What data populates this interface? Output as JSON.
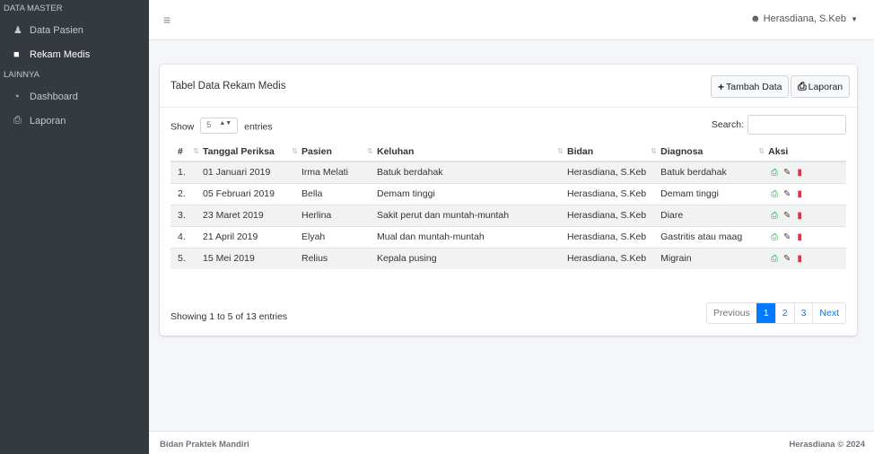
{
  "sidebar": {
    "heading_master": "DATA MASTER",
    "heading_other": "LAINNYA",
    "items": [
      {
        "label": "Data Pasien",
        "icon": "user-group-icon"
      },
      {
        "label": "Rekam Medis",
        "icon": "clipboard-icon",
        "active": true
      },
      {
        "label": "Dashboard",
        "icon": "dashboard-icon"
      },
      {
        "label": "Laporan",
        "icon": "printer-icon"
      }
    ]
  },
  "topbar": {
    "menu_icon": "hamburger-icon",
    "user_name": "Herasdiana, S.Keb"
  },
  "card": {
    "title": "Tabel Data Rekam Medis",
    "add_label": "Tambah Data",
    "report_label": "Laporan"
  },
  "controls": {
    "show_label": "Show",
    "entries_value": "5",
    "entries_label": "entries",
    "search_label": "Search:"
  },
  "table": {
    "columns": [
      "#",
      "Tanggal Periksa",
      "Pasien",
      "Keluhan",
      "Bidan",
      "Diagnosa",
      "Aksi"
    ],
    "rows": [
      {
        "no": "1.",
        "tanggal": "01 Januari 2019",
        "pasien": "Irma Melati",
        "keluhan": "Batuk berdahak",
        "bidan": "Herasdiana, S.Keb",
        "diagnosa": "Batuk berdahak"
      },
      {
        "no": "2.",
        "tanggal": "05 Februari 2019",
        "pasien": "Bella",
        "keluhan": "Demam tinggi",
        "bidan": "Herasdiana, S.Keb",
        "diagnosa": "Demam tinggi"
      },
      {
        "no": "3.",
        "tanggal": "23 Maret 2019",
        "pasien": "Herlina",
        "keluhan": "Sakit perut dan muntah-muntah",
        "bidan": "Herasdiana, S.Keb",
        "diagnosa": "Diare"
      },
      {
        "no": "4.",
        "tanggal": "21 April 2019",
        "pasien": "Elyah",
        "keluhan": "Mual dan muntah-muntah",
        "bidan": "Herasdiana, S.Keb",
        "diagnosa": "Gastritis atau maag"
      },
      {
        "no": "5.",
        "tanggal": "15 Mei 2019",
        "pasien": "Relius",
        "keluhan": "Kepala pusing",
        "bidan": "Herasdiana, S.Keb",
        "diagnosa": "Migrain"
      }
    ]
  },
  "pagination": {
    "info": "Showing 1 to 5 of 13 entries",
    "previous": "Previous",
    "pages": [
      "1",
      "2",
      "3"
    ],
    "current": "1",
    "next": "Next"
  },
  "footer": {
    "left": "Bidan Praktek Mandiri",
    "right": "Herasdiana © 2024"
  },
  "colors": {
    "sidebar": "#343a40",
    "primary": "#007bff",
    "print": "#28a745",
    "delete": "#dc3545"
  }
}
